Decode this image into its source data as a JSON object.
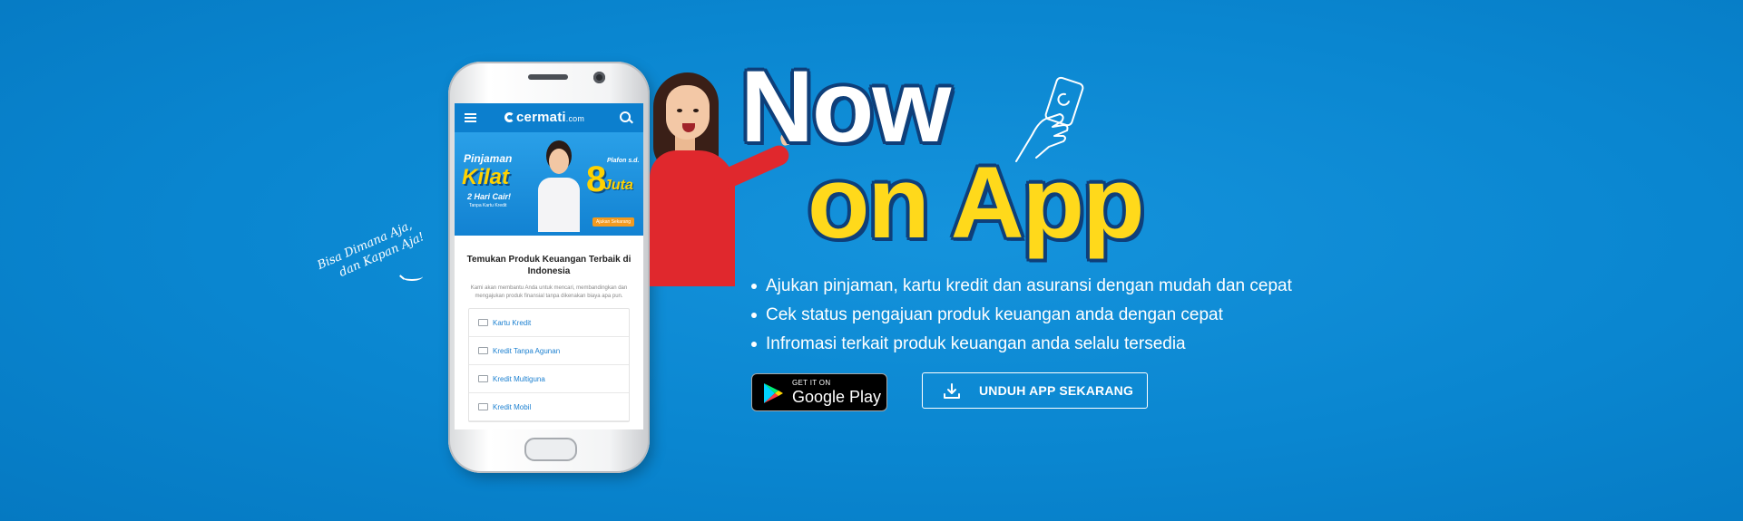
{
  "phone": {
    "app_logo": "cermati",
    "app_logo_suffix": ".com",
    "promo": {
      "line1": "Pinjaman",
      "line2": "Kilat",
      "line3": "2 Hari Cair!",
      "line4": "Tanpa Kartu Kredit",
      "plafon": "Plafon s.d.",
      "amount": "8",
      "unit": "Juta",
      "cta": "Ajukan Sekarang"
    },
    "screen_title": "Temukan Produk Keuangan Terbaik di Indonesia",
    "screen_desc": "Kami akan membantu Anda untuk mencari, membandingkan dan mengajukan produk finansial tanpa dikenakan biaya apa pun.",
    "products": [
      {
        "label": "Kartu Kredit"
      },
      {
        "label": "Kredit Tanpa Agunan"
      },
      {
        "label": "Kredit Multiguna"
      },
      {
        "label": "Kredit Mobil"
      }
    ]
  },
  "note": {
    "line1": "Bisa Dimana Aja,",
    "line2": "dan Kapan Aja!"
  },
  "headline": {
    "line1": "Now",
    "line2": "on App"
  },
  "bullets": [
    "Ajukan pinjaman, kartu kredit dan asuransi dengan mudah dan cepat",
    "Cek status pengajuan produk keuangan anda dengan cepat",
    "Infromasi terkait produk keuangan anda selalu tersedia"
  ],
  "google_play": {
    "small": "GET IT ON",
    "large": "Google Play"
  },
  "download_button": {
    "label": "UNDUH APP SEKARANG"
  },
  "colors": {
    "background": "#0a86d0",
    "headline_white": "#ffffff",
    "headline_yellow": "#ffd91b",
    "outline": "#0e3f7a"
  }
}
